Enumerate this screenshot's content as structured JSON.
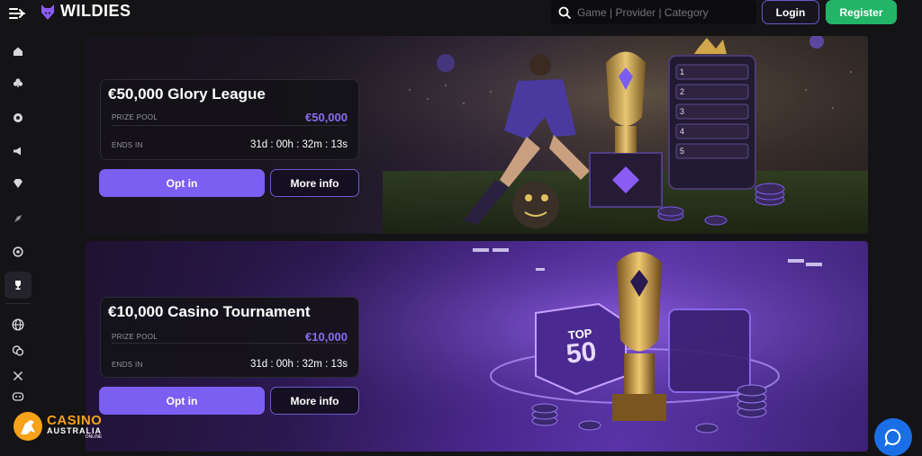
{
  "header": {
    "brand": "WILDIES",
    "search_placeholder": "Game | Provider | Category",
    "login_label": "Login",
    "register_label": "Register"
  },
  "sidebar": {
    "items": [
      {
        "icon": "home-icon"
      },
      {
        "icon": "cards-icon"
      },
      {
        "icon": "roulette-icon"
      },
      {
        "icon": "megaphone-icon"
      },
      {
        "icon": "diamond-icon"
      },
      {
        "icon": "rocket-icon"
      },
      {
        "icon": "target-icon"
      },
      {
        "icon": "trophy-icon",
        "active": true
      },
      {
        "icon": "globe-icon"
      },
      {
        "icon": "chat-bubbles-icon"
      },
      {
        "icon": "x-icon"
      },
      {
        "icon": "discord-icon"
      }
    ]
  },
  "tournaments": [
    {
      "title": "€50,000 Glory League",
      "prize_label": "PRIZE POOL",
      "prize_value": "€50,000",
      "ends_label": "ENDS IN",
      "ends_value": "31d : 00h : 32m : 13s",
      "opt_in_label": "Opt in",
      "more_info_label": "More info"
    },
    {
      "title": "€10,000 Casino Tournament",
      "prize_label": "PRIZE POOL",
      "prize_value": "€10,000",
      "ends_label": "ENDS IN",
      "ends_value": "31d : 00h : 32m : 13s",
      "opt_in_label": "Opt in",
      "more_info_label": "More info",
      "badge_line1": "TOP",
      "badge_line2": "50"
    }
  ],
  "leaderboard_ranks": [
    "1",
    "2",
    "3",
    "4",
    "5"
  ],
  "watermark": {
    "line1": "CASINO",
    "line2": "AUSTRALIA",
    "line3": "ONLINE"
  },
  "colors": {
    "accent": "#7b5ff3",
    "register": "#22b567",
    "chat": "#1a6ee6"
  }
}
